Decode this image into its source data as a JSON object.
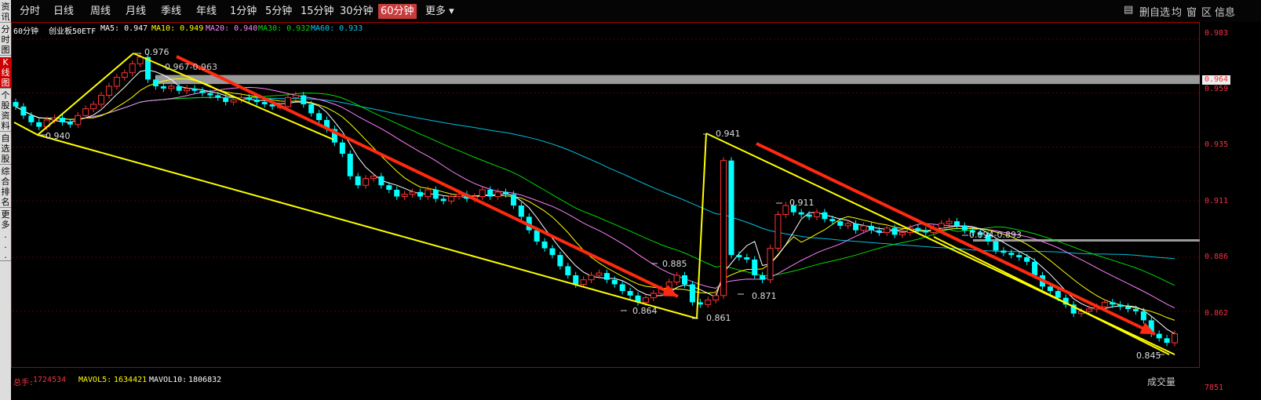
{
  "period_tabs": [
    "分时",
    "日线",
    "周线",
    "月线",
    "季线",
    "年线",
    "1分钟",
    "5分钟",
    "15分钟",
    "30分钟",
    "60分钟",
    "更多 ▾"
  ],
  "active_period": "60分钟",
  "right_tools": [
    "▤",
    "删自选",
    "均",
    "窗",
    "区",
    "信息"
  ],
  "left_sidebar": [
    "资讯",
    "分时图",
    "K线图",
    "个股资料",
    "自选股",
    "综合排名",
    "更多..."
  ],
  "active_left": "K线图",
  "chart_header": {
    "period": "60分钟",
    "name": "创业板50ETF",
    "ma5": "MA5: 0.947",
    "ma10": "MA10: 0.949",
    "ma20": "MA20: 0.940",
    "ma30": "MA30: 0.932",
    "ma60": "MA60: 0.933"
  },
  "colors": {
    "ma5": "#ffffff",
    "ma10": "#ffff00",
    "ma20": "#ff80ff",
    "ma30": "#00dd00",
    "ma60": "#00c0e0",
    "up": "#ff3333",
    "down": "#00ffff",
    "trend": "#ffff00",
    "arrow": "#ff2a10",
    "zone": "#9a9a9a"
  },
  "price_axis": [
    "0.983",
    "0.959",
    "0.935",
    "0.911",
    "0.886",
    "0.862",
    "7851"
  ],
  "highlight_price": "0.964",
  "annotations": [
    {
      "text": "0.976"
    },
    {
      "text": "0.967-0.963"
    },
    {
      "text": "0.940"
    },
    {
      "text": "0.941"
    },
    {
      "text": "0.911"
    },
    {
      "text": "0.885"
    },
    {
      "text": "0.864"
    },
    {
      "text": "0.861"
    },
    {
      "text": "0.871"
    },
    {
      "text": "0.894-0.893"
    },
    {
      "text": "0.845"
    }
  ],
  "volume": {
    "total_label": "总手:",
    "total": "1724534",
    "mavol5_label": "MAVOL5:",
    "mavol5": "1634421",
    "mavol10_label": "MAVOL10:",
    "mavol10": "1806832",
    "tab": "成交量"
  },
  "chart_data": {
    "type": "candlestick",
    "ylim": [
      0.84,
      0.985
    ],
    "closes": [
      0.953,
      0.949,
      0.946,
      0.944,
      0.947,
      0.948,
      0.946,
      0.945,
      0.949,
      0.952,
      0.954,
      0.958,
      0.962,
      0.966,
      0.968,
      0.972,
      0.975,
      0.965,
      0.962,
      0.961,
      0.962,
      0.96,
      0.961,
      0.96,
      0.959,
      0.958,
      0.957,
      0.955,
      0.956,
      0.957,
      0.956,
      0.955,
      0.954,
      0.953,
      0.953,
      0.957,
      0.958,
      0.954,
      0.95,
      0.947,
      0.943,
      0.937,
      0.932,
      0.922,
      0.918,
      0.921,
      0.922,
      0.918,
      0.916,
      0.913,
      0.914,
      0.915,
      0.913,
      0.916,
      0.912,
      0.911,
      0.913,
      0.914,
      0.912,
      0.913,
      0.916,
      0.913,
      0.915,
      0.914,
      0.909,
      0.904,
      0.898,
      0.893,
      0.89,
      0.887,
      0.882,
      0.878,
      0.874,
      0.876,
      0.878,
      0.879,
      0.876,
      0.874,
      0.871,
      0.869,
      0.866,
      0.868,
      0.87,
      0.872,
      0.875,
      0.878,
      0.874,
      0.866,
      0.865,
      0.867,
      0.869,
      0.929,
      0.887,
      0.886,
      0.885,
      0.878,
      0.876,
      0.89,
      0.905,
      0.909,
      0.906,
      0.905,
      0.904,
      0.906,
      0.903,
      0.902,
      0.9,
      0.901,
      0.898,
      0.9,
      0.898,
      0.897,
      0.899,
      0.896,
      0.897,
      0.899,
      0.898,
      0.897,
      0.899,
      0.901,
      0.902,
      0.9,
      0.898,
      0.897,
      0.896,
      0.893,
      0.889,
      0.888,
      0.887,
      0.886,
      0.884,
      0.878,
      0.873,
      0.871,
      0.868,
      0.865,
      0.861,
      0.862,
      0.863,
      0.864,
      0.866,
      0.865,
      0.864,
      0.863,
      0.862,
      0.858,
      0.852,
      0.85,
      0.848,
      0.852
    ],
    "labels": {
      "high_1": 0.976,
      "zone_1": [
        0.967,
        0.963
      ],
      "low_1": 0.94,
      "high_2": 0.941,
      "local_high": 0.911,
      "local_high_2": 0.885,
      "low_2": 0.864,
      "low_3": 0.861,
      "low_4": 0.871,
      "zone_2": [
        0.894,
        0.893
      ],
      "low_5": 0.845
    }
  }
}
